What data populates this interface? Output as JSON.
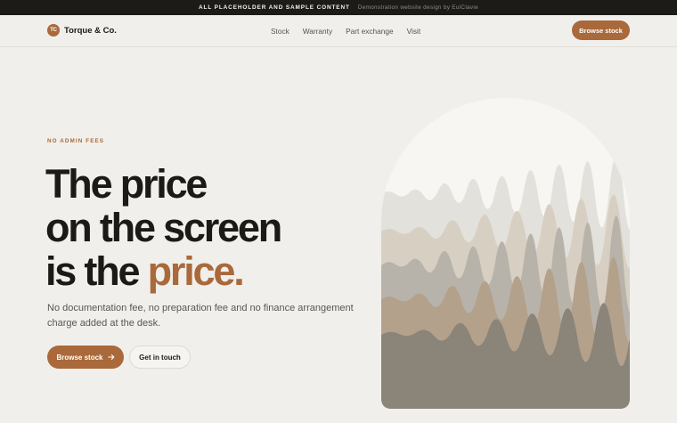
{
  "topbar": {
    "notice": "ALL PLACEHOLDER AND SAMPLE CONTENT",
    "credit": "Demonstration website design by EulClavie"
  },
  "nav": {
    "logo_initials": "TC",
    "brand": "Torque & Co.",
    "links": [
      "Stock",
      "Warranty",
      "Part exchange",
      "Visit"
    ],
    "cta": "Browse stock"
  },
  "hero": {
    "eyebrow": "NO ADMIN FEES",
    "headline_lines": [
      "The price",
      "on the screen",
      "is the "
    ],
    "headline_accent": "price.",
    "lede": "No documentation fee, no preparation fee and no finance arrangement charge added at the desk.",
    "primary_cta": "Browse stock",
    "primary_cta_icon": "arrow-right-icon",
    "secondary_cta": "Get in touch"
  },
  "colors": {
    "accent": "#a9693a",
    "topbar_bg": "#1c1b18",
    "page_bg": "#f1efeb",
    "text": "#1b1a17",
    "art_layers": [
      "#f8f6f2",
      "#e3e1dc",
      "#d8cfc3",
      "#b8b3aa",
      "#b3a18b",
      "#8a8479"
    ]
  }
}
